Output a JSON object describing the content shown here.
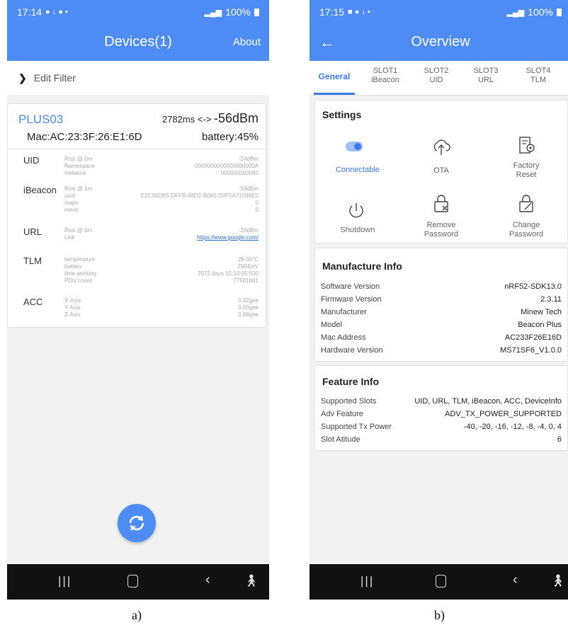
{
  "left": {
    "status": {
      "time": "17:14",
      "icons": "● ↓ ●  •",
      "battery": "100%"
    },
    "title": "Devices(1)",
    "about": "About",
    "filter": "Edit Filter",
    "device": {
      "name": "PLUS03",
      "interval": "2782ms <-> ",
      "rssi": "-56dBm",
      "mac": "Mac:AC:23:3F:26:E1:6D",
      "battery": "battery:45%"
    },
    "frames": [
      {
        "type": "UID",
        "rows": [
          {
            "k": "Rssi @ 0m",
            "v": "-24dBm"
          },
          {
            "k": "Namespace",
            "v": "0000000000000000000A"
          },
          {
            "k": "Instance",
            "v": "000000000090"
          }
        ]
      },
      {
        "type": "iBeacon",
        "rows": [
          {
            "k": "Rssi @ 1m",
            "v": "-59dBm"
          },
          {
            "k": "uuid",
            "v": "E2C56DB5-DFFB-48D2-B060-D0F5A71096E0"
          },
          {
            "k": "major",
            "v": "0"
          },
          {
            "k": "minor",
            "v": "0"
          }
        ]
      },
      {
        "type": "URL",
        "rows": [
          {
            "k": "Rssi @ 0m",
            "v": "-24dBm"
          },
          {
            "k": "Link",
            "v": "https://www.google.com/"
          }
        ]
      },
      {
        "type": "TLM",
        "rows": [
          {
            "k": "temperature",
            "v": "28.00°C"
          },
          {
            "k": "battery",
            "v": "2904mV"
          },
          {
            "k": "time working",
            "v": "2072 days 15:10:05:500"
          },
          {
            "k": "PDU count",
            "v": "77581681"
          }
        ]
      },
      {
        "type": "ACC",
        "rows": [
          {
            "k": "X-Axis",
            "v": "0.02gee"
          },
          {
            "k": "Y-Axis",
            "v": "0.00gee"
          },
          {
            "k": "Z-Axis",
            "v": "0.96gee"
          }
        ]
      }
    ],
    "caption": "a)"
  },
  "right": {
    "status": {
      "time": "17:15",
      "icons": "■ ● ↓  •",
      "battery": "100%"
    },
    "title": "Overview",
    "tabs": [
      {
        "line1": "General",
        "line2": ""
      },
      {
        "line1": "SLOT1",
        "line2": "iBeacon"
      },
      {
        "line1": "SLOT2",
        "line2": "UID"
      },
      {
        "line1": "SLOT3",
        "line2": "URL"
      },
      {
        "line1": "SLOT4",
        "line2": "TLM"
      }
    ],
    "settings": {
      "title": "Settings",
      "options": [
        {
          "label": "Connectable"
        },
        {
          "label": "OTA"
        },
        {
          "label": "Factory\nReset"
        },
        {
          "label": "Shutdown"
        },
        {
          "label": "Remove\nPassword"
        },
        {
          "label": "Change\nPassword"
        }
      ]
    },
    "manufacture": {
      "title": "Manufacture Info",
      "rows": [
        {
          "k": "Software Version",
          "v": "nRF52-SDK13.0"
        },
        {
          "k": "Firmware Version",
          "v": "2.3.11"
        },
        {
          "k": "Manufacturer",
          "v": "Minew Tech"
        },
        {
          "k": "Model",
          "v": "Beacon Plus"
        },
        {
          "k": "Mac Address",
          "v": "AC233F26E16D"
        },
        {
          "k": "Hardware Version",
          "v": "MS71SF6_V1.0.0"
        }
      ]
    },
    "feature": {
      "title": "Feature Info",
      "rows": [
        {
          "k": "Supported Slots",
          "v": "UID, URL, TLM, iBeacon, ACC, DeviceInfo"
        },
        {
          "k": "Adv Feature",
          "v": "ADV_TX_POWER_SUPPORTED"
        },
        {
          "k": "Supported Tx Power",
          "v": "-40, -20, -16, -12, -8, -4, 0, 4"
        },
        {
          "k": "Slot Atitude",
          "v": "6"
        }
      ]
    },
    "caption": "b)"
  },
  "colors": {
    "accent": "#4d8cf5",
    "tab_active": "#3a7cf0",
    "link": "#2f6fd6"
  }
}
